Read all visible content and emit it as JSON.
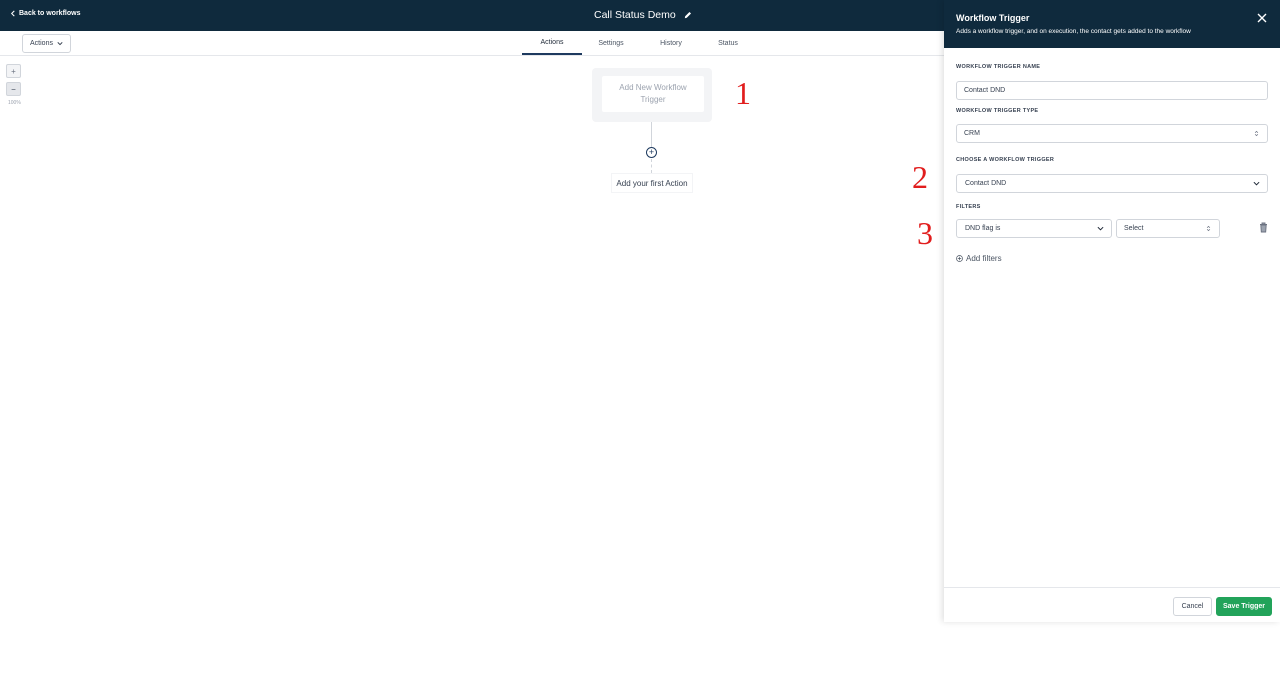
{
  "header": {
    "back_label": "Back to workflows",
    "workflow_title": "Call Status Demo"
  },
  "toolbar": {
    "actions_label": "Actions",
    "tabs": [
      {
        "label": "Actions",
        "active": true
      },
      {
        "label": "Settings",
        "active": false
      },
      {
        "label": "History",
        "active": false
      },
      {
        "label": "Status",
        "active": false
      }
    ]
  },
  "canvas": {
    "zoom_in": "+",
    "zoom_out": "−",
    "zoom_level": "100%",
    "trigger_placeholder": "Add New Workflow Trigger",
    "add_step": "+",
    "first_action": "Add your first Action"
  },
  "annotations": [
    "1",
    "2",
    "3"
  ],
  "panel": {
    "title": "Workflow Trigger",
    "subtitle": "Adds a workflow trigger, and on execution, the contact gets added to the workflow",
    "trigger_name_label": "WORKFLOW TRIGGER NAME",
    "trigger_name_value": "Contact DND",
    "trigger_type_label": "WORKFLOW TRIGGER TYPE",
    "trigger_type_value": "CRM",
    "choose_trigger_label": "CHOOSE A WORKFLOW TRIGGER",
    "choose_trigger_value": "Contact DND",
    "filters_label": "FILTERS",
    "filter_field_value": "DND flag is",
    "filter_value_placeholder": "Select",
    "add_filters_label": "Add filters",
    "cancel_label": "Cancel",
    "save_label": "Save Trigger"
  },
  "colors": {
    "header_bg": "#0f2a3d",
    "save_button": "#22a35a",
    "annotation": "#e11d1d",
    "active_tab": "#1e3a5f"
  },
  "icons": [
    "chevron-left-icon",
    "pencil-icon",
    "chevron-down-icon",
    "plus-circle-icon",
    "close-icon",
    "select-arrows-icon",
    "trash-icon",
    "add-circle-icon"
  ]
}
